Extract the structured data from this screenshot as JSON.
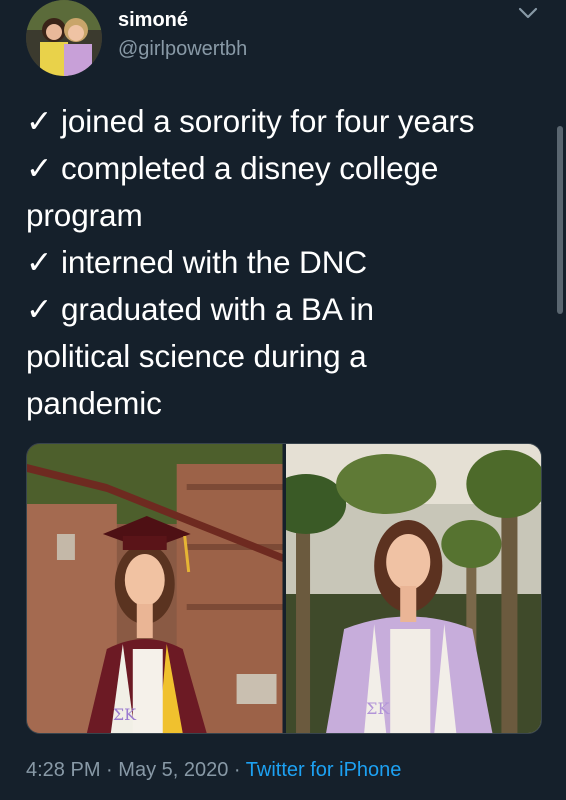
{
  "user": {
    "name": "simoné",
    "handle": "@girlpowertbh"
  },
  "tweet": {
    "lines": [
      "✓ joined a sorority for four years",
      "✓ completed a disney college",
      "program",
      "✓ interned with the DNC",
      "✓ graduated with a BA in",
      "political science during a",
      "pandemic"
    ]
  },
  "media": {
    "left_stole_letters": "ΣK",
    "right_stole_letters": "ΣK"
  },
  "meta": {
    "time": "4:28 PM",
    "separator": "·",
    "date": "May 5, 2020",
    "source": "Twitter for iPhone"
  },
  "icons": {
    "menu": "chevron-down-icon"
  },
  "colors": {
    "background": "#15202b",
    "secondary_text": "#8899a6",
    "link": "#1da1f2"
  }
}
